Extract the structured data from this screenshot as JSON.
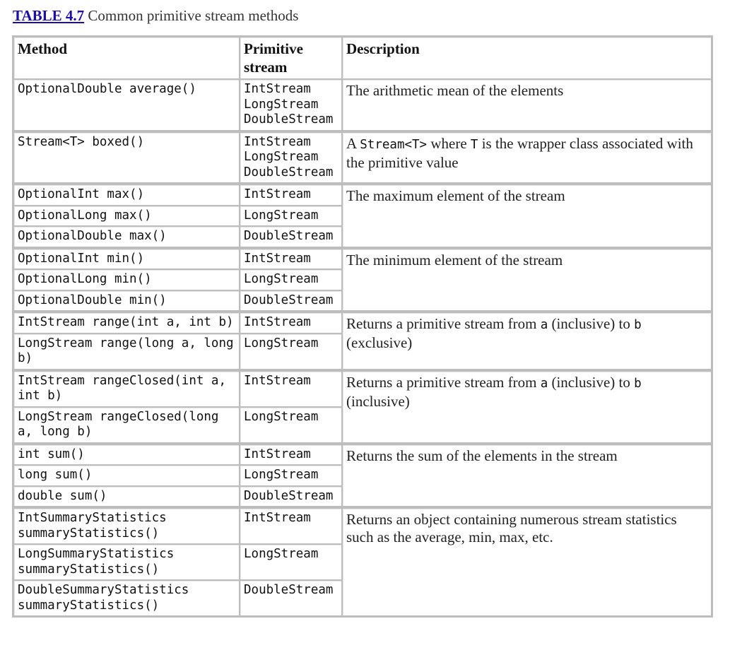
{
  "caption": {
    "label": "TABLE 4.7",
    "text": " Common primitive stream methods"
  },
  "table": {
    "headers": {
      "method": "Method",
      "stream_line1": "Primitive",
      "stream_line2": "stream",
      "description": "Description"
    },
    "groups": [
      {
        "description": "The arithmetic mean of the elements",
        "rows": [
          {
            "method": "OptionalDouble average()",
            "streams": [
              "IntStream",
              "LongStream",
              "DoubleStream"
            ]
          }
        ]
      },
      {
        "description_parts": {
          "a": "A ",
          "code1": "Stream<T>",
          "b": " where ",
          "code2": "T",
          "c": " is the wrapper class associated with the primitive value"
        },
        "rows": [
          {
            "method": "Stream<T> boxed()",
            "streams": [
              "IntStream",
              "LongStream",
              "DoubleStream"
            ]
          }
        ]
      },
      {
        "description": "The maximum element of the stream",
        "rows": [
          {
            "method": "OptionalInt max()",
            "streams": [
              "IntStream"
            ]
          },
          {
            "method": "OptionalLong max()",
            "streams": [
              "LongStream"
            ]
          },
          {
            "method": "OptionalDouble max()",
            "streams": [
              "DoubleStream"
            ]
          }
        ]
      },
      {
        "description": "The minimum element of the stream",
        "rows": [
          {
            "method": "OptionalInt min()",
            "streams": [
              "IntStream"
            ]
          },
          {
            "method": "OptionalLong min()",
            "streams": [
              "LongStream"
            ]
          },
          {
            "method": "OptionalDouble min()",
            "streams": [
              "DoubleStream"
            ]
          }
        ]
      },
      {
        "description_parts": {
          "a": "Returns a primitive stream from ",
          "code1": "a",
          "b": " (inclusive) to ",
          "code2": "b",
          "c": " (exclusive)"
        },
        "rows": [
          {
            "method": "IntStream range(int a, int b)",
            "streams": [
              "IntStream"
            ]
          },
          {
            "method": "LongStream range(long a, long b)",
            "streams": [
              "LongStream"
            ]
          }
        ]
      },
      {
        "description_parts": {
          "a": "Returns a primitive stream from ",
          "code1": "a",
          "b": " (inclusive) to ",
          "code2": "b",
          "c": " (inclusive)"
        },
        "rows": [
          {
            "method": "IntStream rangeClosed(int a, int b)",
            "streams": [
              "IntStream"
            ]
          },
          {
            "method": "LongStream rangeClosed(long a, long b)",
            "streams": [
              "LongStream"
            ]
          }
        ]
      },
      {
        "description": "Returns the sum of the elements in the stream",
        "rows": [
          {
            "method": "int sum()",
            "streams": [
              "IntStream"
            ]
          },
          {
            "method": "long sum()",
            "streams": [
              "LongStream"
            ]
          },
          {
            "method": "double sum()",
            "streams": [
              "DoubleStream"
            ]
          }
        ]
      },
      {
        "description": "Returns an object containing numerous stream statistics such as the average, min, max, etc.",
        "rows": [
          {
            "method": "IntSummaryStatistics summaryStatistics()",
            "streams": [
              "IntStream"
            ]
          },
          {
            "method": "LongSummaryStatistics summaryStatistics()",
            "streams": [
              "LongStream"
            ]
          },
          {
            "method": "DoubleSummaryStatistics summaryStatistics()",
            "streams": [
              "DoubleStream"
            ]
          }
        ]
      }
    ]
  }
}
